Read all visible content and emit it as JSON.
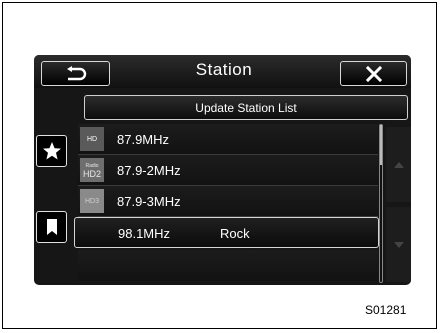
{
  "header": {
    "title": "Station",
    "back_icon": "back-return-icon",
    "close_icon": "close-x-icon"
  },
  "update_button": {
    "label": "Update Station List"
  },
  "side_buttons": [
    {
      "name": "favorite",
      "icon": "star-icon"
    },
    {
      "name": "bookmark",
      "icon": "bookmark-icon"
    }
  ],
  "stations": [
    {
      "freq": "87.9MHz",
      "genre": "",
      "logo": "HD",
      "selected": false
    },
    {
      "freq": "87.9-2MHz",
      "genre": "",
      "logo": "HD2",
      "selected": false
    },
    {
      "freq": "87.9-3MHz",
      "genre": "",
      "logo": "HD3",
      "selected": false
    },
    {
      "freq": "98.1MHz",
      "genre": "Rock",
      "logo": "",
      "selected": true
    }
  ],
  "station_logos": {
    "hd": "HD",
    "hd2_small": "Radio",
    "hd2": "HD2",
    "hd3": "HD3"
  },
  "scroll": {
    "up_icon": "scroll-up-arrow-icon",
    "down_icon": "scroll-down-arrow-icon"
  },
  "caption": "S01281"
}
